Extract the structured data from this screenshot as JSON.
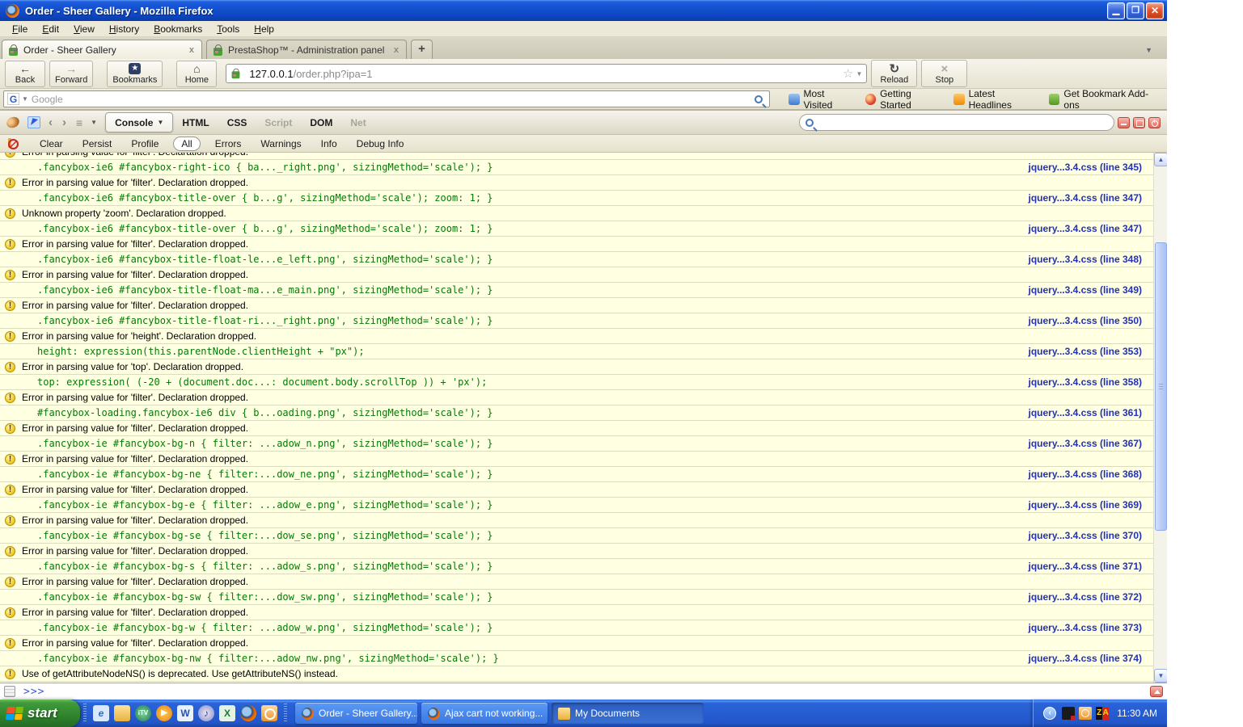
{
  "window": {
    "title": "Order - Sheer Gallery - Mozilla Firefox"
  },
  "menubar": [
    "File",
    "Edit",
    "View",
    "History",
    "Bookmarks",
    "Tools",
    "Help"
  ],
  "tab_strip": {
    "tabs": [
      {
        "label": "Order - Sheer Gallery",
        "active": true,
        "close": "x"
      },
      {
        "label": "PrestaShop™ - Administration panel",
        "active": false,
        "close": "x"
      }
    ],
    "new_tab_label": "+"
  },
  "nav": {
    "back_label": "Back",
    "forward_label": "Forward",
    "bookmarks_label": "Bookmarks",
    "home_label": "Home",
    "url": {
      "host": "127.0.0.1",
      "path": "/order.php?ipa=1"
    },
    "reload_label": "Reload",
    "stop_label": "Stop"
  },
  "search": {
    "engine_placeholder": "Google"
  },
  "bookmarks_bar": [
    {
      "icon": "most-visited",
      "label": "Most Visited"
    },
    {
      "icon": "getting-started",
      "label": "Getting Started"
    },
    {
      "icon": "latest-headlines",
      "label": "Latest Headlines"
    },
    {
      "icon": "addons",
      "label": "Get Bookmark Add-ons"
    }
  ],
  "firebug": {
    "panels": [
      {
        "label": "Console",
        "active": true
      },
      {
        "label": "HTML"
      },
      {
        "label": "CSS"
      },
      {
        "label": "Script",
        "disabled": true
      },
      {
        "label": "DOM"
      },
      {
        "label": "Net",
        "disabled": true
      }
    ],
    "filters": [
      {
        "label": "Clear"
      },
      {
        "label": "Persist"
      },
      {
        "label": "Profile"
      },
      {
        "label": "All",
        "selected": true
      },
      {
        "label": "Errors"
      },
      {
        "label": "Warnings"
      },
      {
        "label": "Info"
      },
      {
        "label": "Debug Info"
      }
    ],
    "console_entries": [
      {
        "clipped": true,
        "message": "Error in parsing value for 'filter'. Declaration dropped.",
        "code": ".fancybox-ie6 #fancybox-right-ico { ba..._right.png', sizingMethod='scale'); }",
        "link": "jquery...3.4.css (line 345)"
      },
      {
        "message": "Error in parsing value for 'filter'. Declaration dropped.",
        "code": ".fancybox-ie6 #fancybox-title-over { b...g', sizingMethod='scale'); zoom: 1; }",
        "link": "jquery...3.4.css (line 347)"
      },
      {
        "message": "Unknown property 'zoom'. Declaration dropped.",
        "code": ".fancybox-ie6 #fancybox-title-over { b...g', sizingMethod='scale'); zoom: 1; }",
        "link": "jquery...3.4.css (line 347)"
      },
      {
        "message": "Error in parsing value for 'filter'. Declaration dropped.",
        "code": ".fancybox-ie6 #fancybox-title-float-le...e_left.png', sizingMethod='scale'); }",
        "link": "jquery...3.4.css (line 348)"
      },
      {
        "message": "Error in parsing value for 'filter'. Declaration dropped.",
        "code": ".fancybox-ie6 #fancybox-title-float-ma...e_main.png', sizingMethod='scale'); }",
        "link": "jquery...3.4.css (line 349)"
      },
      {
        "message": "Error in parsing value for 'filter'. Declaration dropped.",
        "code": ".fancybox-ie6 #fancybox-title-float-ri..._right.png', sizingMethod='scale'); }",
        "link": "jquery...3.4.css (line 350)"
      },
      {
        "message": "Error in parsing value for 'height'. Declaration dropped.",
        "code": "height: expression(this.parentNode.clientHeight + \"px\");",
        "link": "jquery...3.4.css (line 353)"
      },
      {
        "message": "Error in parsing value for 'top'. Declaration dropped.",
        "code": "top: expression( (-20 + (document.doc...: document.body.scrollTop )) + 'px');",
        "link": "jquery...3.4.css (line 358)"
      },
      {
        "message": "Error in parsing value for 'filter'. Declaration dropped.",
        "code": "#fancybox-loading.fancybox-ie6 div { b...oading.png', sizingMethod='scale'); }",
        "link": "jquery...3.4.css (line 361)"
      },
      {
        "message": "Error in parsing value for 'filter'. Declaration dropped.",
        "code": ".fancybox-ie #fancybox-bg-n { filter: ...adow_n.png', sizingMethod='scale'); }",
        "link": "jquery...3.4.css (line 367)"
      },
      {
        "message": "Error in parsing value for 'filter'. Declaration dropped.",
        "code": ".fancybox-ie #fancybox-bg-ne { filter:...dow_ne.png', sizingMethod='scale'); }",
        "link": "jquery...3.4.css (line 368)"
      },
      {
        "message": "Error in parsing value for 'filter'. Declaration dropped.",
        "code": ".fancybox-ie #fancybox-bg-e { filter: ...adow_e.png', sizingMethod='scale'); }",
        "link": "jquery...3.4.css (line 369)"
      },
      {
        "message": "Error in parsing value for 'filter'. Declaration dropped.",
        "code": ".fancybox-ie #fancybox-bg-se { filter:...dow_se.png', sizingMethod='scale'); }",
        "link": "jquery...3.4.css (line 370)"
      },
      {
        "message": "Error in parsing value for 'filter'. Declaration dropped.",
        "code": ".fancybox-ie #fancybox-bg-s { filter: ...adow_s.png', sizingMethod='scale'); }",
        "link": "jquery...3.4.css (line 371)"
      },
      {
        "message": "Error in parsing value for 'filter'. Declaration dropped.",
        "code": ".fancybox-ie #fancybox-bg-sw { filter:...dow_sw.png', sizingMethod='scale'); }",
        "link": "jquery...3.4.css (line 372)"
      },
      {
        "message": "Error in parsing value for 'filter'. Declaration dropped.",
        "code": ".fancybox-ie #fancybox-bg-w { filter: ...adow_w.png', sizingMethod='scale'); }",
        "link": "jquery...3.4.css (line 373)"
      },
      {
        "message": "Error in parsing value for 'filter'. Declaration dropped.",
        "code": ".fancybox-ie #fancybox-bg-nw { filter:...adow_nw.png', sizingMethod='scale'); }",
        "link": "jquery...3.4.css (line 374)"
      },
      {
        "message": "Use of getAttributeNodeNS() is deprecated. Use getAttributeNS() instead."
      }
    ],
    "command_prompt": ">>>"
  },
  "taskbar": {
    "start_label": "start",
    "quick_launch": [
      {
        "icon": "ie",
        "glyph": "e"
      },
      {
        "icon": "folder",
        "glyph": ""
      },
      {
        "icon": "globe",
        "glyph": "iTV"
      },
      {
        "icon": "media-player",
        "glyph": "▶"
      },
      {
        "icon": "word",
        "glyph": "W"
      },
      {
        "icon": "itunes",
        "glyph": "♪"
      },
      {
        "icon": "excel",
        "glyph": "X"
      },
      {
        "icon": "firefox",
        "glyph": ""
      },
      {
        "icon": "clock",
        "glyph": ""
      }
    ],
    "tasks": [
      {
        "icon": "firefox",
        "label": "Order - Sheer Gallery..."
      },
      {
        "icon": "firefox",
        "label": "Ajax cart not working..."
      },
      {
        "icon": "folder",
        "label": "My Documents",
        "pressed": true
      }
    ],
    "tray": {
      "icons": [
        {
          "icon": "network"
        },
        {
          "icon": "sync-clock"
        },
        {
          "icon": "zonealarm"
        }
      ],
      "time": "11:30 AM"
    }
  }
}
